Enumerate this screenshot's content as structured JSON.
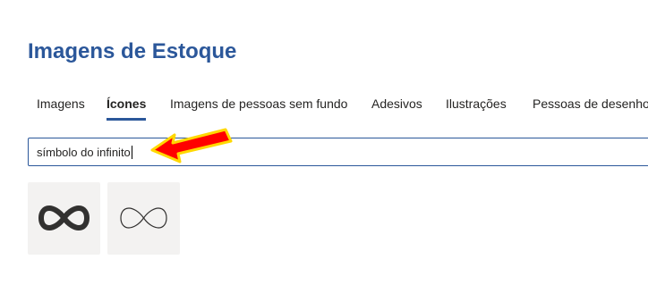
{
  "page": {
    "title": "Imagens de Estoque"
  },
  "tabs": [
    {
      "label": "Imagens",
      "active": false
    },
    {
      "label": "Ícones",
      "active": true
    },
    {
      "label": "Imagens de pessoas sem fundo",
      "active": false
    },
    {
      "label": "Adesivos",
      "active": false
    },
    {
      "label": "Ilustrações",
      "active": false
    },
    {
      "label": "Pessoas de desenhos",
      "active": false
    }
  ],
  "search": {
    "value": "símbolo do infinito"
  },
  "results": [
    {
      "icon": "infinity-bold-icon"
    },
    {
      "icon": "infinity-outline-icon"
    }
  ],
  "colors": {
    "accent": "#2b579a",
    "text": "#252423",
    "tile_background": "#f3f2f1",
    "annotation_arrow": "#ff0000",
    "annotation_arrow_outline": "#ffd800"
  }
}
